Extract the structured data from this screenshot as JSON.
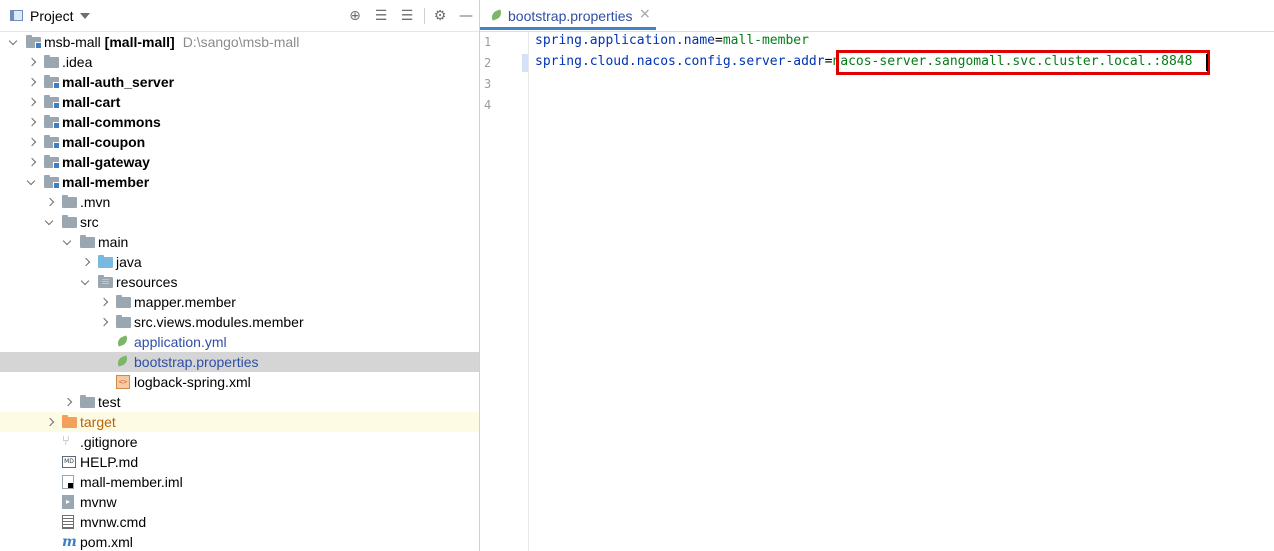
{
  "project_panel": {
    "title": "Project",
    "toolbar": [
      "locate-icon",
      "expand-all-icon",
      "collapse-all-icon",
      "gear-icon",
      "hide-icon"
    ],
    "tree": [
      {
        "label": "msb-mall",
        "suffix": "[mall-mall]",
        "path": "D:\\sango\\msb-mall",
        "depth": 0,
        "expanded": true,
        "icon": "module-folder-icon",
        "bold": false
      },
      {
        "label": ".idea",
        "depth": 1,
        "expanded": false,
        "icon": "folder-icon"
      },
      {
        "label": "mall-auth_server",
        "depth": 1,
        "expanded": false,
        "icon": "module-folder-icon",
        "bold": true
      },
      {
        "label": "mall-cart",
        "depth": 1,
        "expanded": false,
        "icon": "module-folder-icon",
        "bold": true
      },
      {
        "label": "mall-commons",
        "depth": 1,
        "expanded": false,
        "icon": "module-folder-icon",
        "bold": true
      },
      {
        "label": "mall-coupon",
        "depth": 1,
        "expanded": false,
        "icon": "module-folder-icon",
        "bold": true
      },
      {
        "label": "mall-gateway",
        "depth": 1,
        "expanded": false,
        "icon": "module-folder-icon",
        "bold": true
      },
      {
        "label": "mall-member",
        "depth": 1,
        "expanded": true,
        "icon": "module-folder-icon",
        "bold": true
      },
      {
        "label": ".mvn",
        "depth": 2,
        "expanded": false,
        "icon": "folder-icon"
      },
      {
        "label": "src",
        "depth": 2,
        "expanded": true,
        "icon": "folder-icon"
      },
      {
        "label": "main",
        "depth": 3,
        "expanded": true,
        "icon": "folder-icon"
      },
      {
        "label": "java",
        "depth": 4,
        "expanded": false,
        "icon": "source-folder-icon"
      },
      {
        "label": "resources",
        "depth": 4,
        "expanded": true,
        "icon": "resources-folder-icon"
      },
      {
        "label": "mapper.member",
        "depth": 5,
        "expanded": false,
        "icon": "folder-icon"
      },
      {
        "label": "src.views.modules.member",
        "depth": 5,
        "expanded": false,
        "icon": "folder-icon"
      },
      {
        "label": "application.yml",
        "depth": 5,
        "icon": "spring-yml-icon",
        "color": "blue"
      },
      {
        "label": "bootstrap.properties",
        "depth": 5,
        "icon": "spring-leaf-icon",
        "color": "blue",
        "selected": true
      },
      {
        "label": "logback-spring.xml",
        "depth": 5,
        "icon": "xml-file-icon"
      },
      {
        "label": "test",
        "depth": 3,
        "expanded": false,
        "icon": "folder-icon"
      },
      {
        "label": "target",
        "depth": 2,
        "expanded": false,
        "icon": "excluded-folder-icon",
        "color": "orange",
        "excluded": true
      },
      {
        "label": ".gitignore",
        "depth": 2,
        "icon": "gitignore-icon"
      },
      {
        "label": "HELP.md",
        "depth": 2,
        "icon": "markdown-icon"
      },
      {
        "label": "mall-member.iml",
        "depth": 2,
        "icon": "iml-file-icon"
      },
      {
        "label": "mvnw",
        "depth": 2,
        "icon": "script-icon"
      },
      {
        "label": "mvnw.cmd",
        "depth": 2,
        "icon": "cmd-file-icon"
      },
      {
        "label": "pom.xml",
        "depth": 2,
        "icon": "maven-icon"
      }
    ]
  },
  "editor": {
    "tab": {
      "label": "bootstrap.properties",
      "close": "×"
    },
    "lines": [
      {
        "number": "1",
        "key": "spring.application.name",
        "sep": "=",
        "value": "mall-member"
      },
      {
        "number": "2",
        "key": "spring.cloud.nacos.config.server-addr",
        "sep": "=",
        "value": "nacos-server.sangomall.svc.cluster.local.:8848"
      },
      {
        "number": "3",
        "key": "",
        "sep": "",
        "value": ""
      },
      {
        "number": "4",
        "key": "",
        "sep": "",
        "value": ""
      }
    ],
    "highlight_color": "#e00000"
  }
}
